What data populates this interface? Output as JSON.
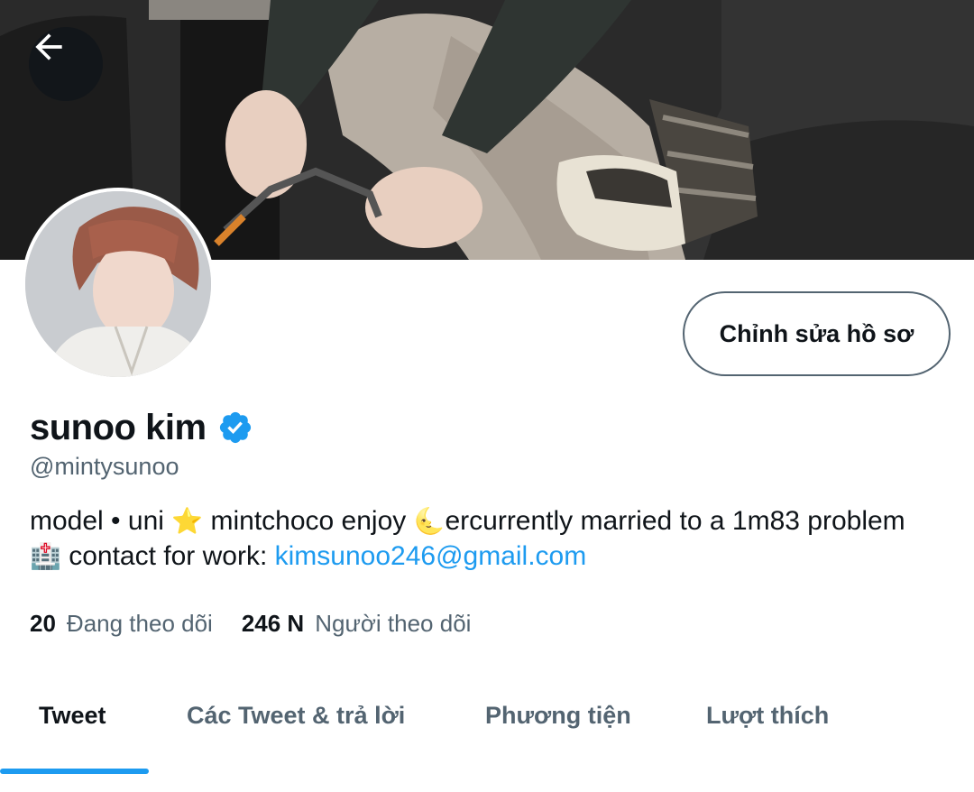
{
  "header": {
    "back_icon": "arrow-left-icon"
  },
  "banner": {
    "description_icon": "banner-photo"
  },
  "profile": {
    "display_name": "sunoo kim",
    "verified_icon": "verified-badge-icon",
    "handle": "@mintysunoo",
    "edit_button_label": "Chỉnh sửa hồ sơ",
    "bio": {
      "part1": "model • uni ",
      "emoji1": "⭐",
      "part2": " mintchoco enjoy ",
      "emoji2": "🌜",
      "part3": "ercurrently married to a 1m83 problem ",
      "emoji3": "🏥",
      "part4": " contact for work: ",
      "email": "kimsunoo246@gmail.com"
    },
    "following_count": "20",
    "following_label": "Đang theo dõi",
    "followers_count": "246 N",
    "followers_label": "Người theo dõi"
  },
  "tabs": [
    {
      "label": "Tweet",
      "active": true
    },
    {
      "label": "Các Tweet & trả lời",
      "active": false
    },
    {
      "label": "Phương tiện",
      "active": false
    },
    {
      "label": "Lượt thích",
      "active": false
    }
  ],
  "colors": {
    "accent": "#1d9bf0",
    "text_primary": "#0f1419",
    "text_secondary": "#536471"
  }
}
